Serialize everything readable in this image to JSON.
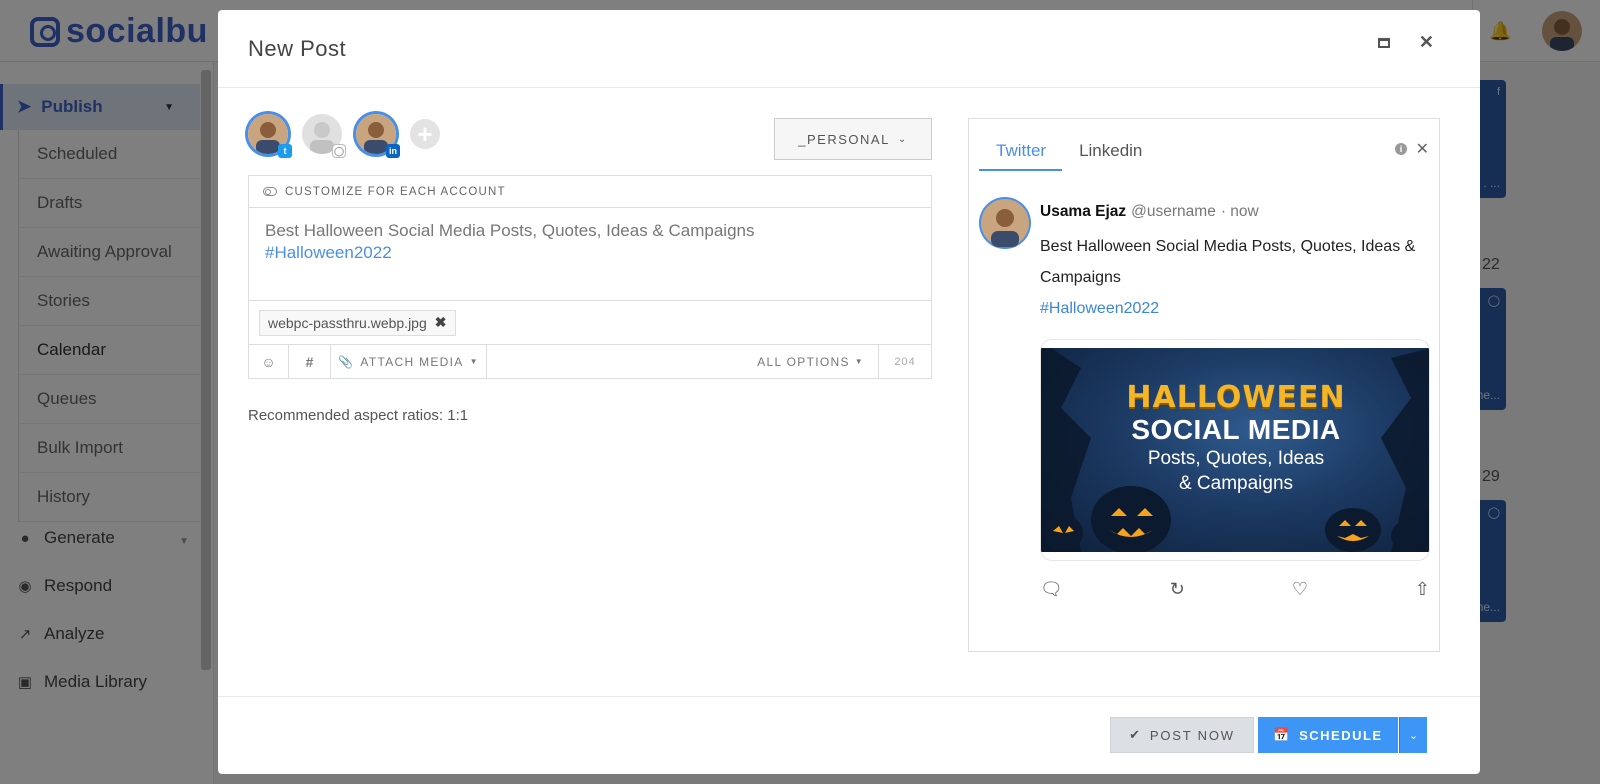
{
  "app": {
    "logo_text": "socialbu"
  },
  "sidebar": {
    "publish_label": "Publish",
    "sub_items": [
      {
        "label": "Scheduled"
      },
      {
        "label": "Drafts"
      },
      {
        "label": "Awaiting Approval"
      },
      {
        "label": "Stories"
      },
      {
        "label": "Calendar"
      },
      {
        "label": "Queues"
      },
      {
        "label": "Bulk Import"
      },
      {
        "label": "History"
      }
    ],
    "main_items": [
      {
        "label": "Generate",
        "icon": "robot-icon"
      },
      {
        "label": "Respond",
        "icon": "chat-icon"
      },
      {
        "label": "Analyze",
        "icon": "chart-icon"
      },
      {
        "label": "Media Library",
        "icon": "image-icon"
      }
    ]
  },
  "calendar": {
    "day_numbers": [
      "22",
      "29"
    ],
    "card_snippets": [
      "day! . . ...",
      ": #me...",
      ": #me..."
    ]
  },
  "modal": {
    "title": "New Post",
    "accounts": [
      {
        "network": "twitter",
        "selected": true
      },
      {
        "network": "instagram",
        "selected": false
      },
      {
        "network": "linkedin",
        "selected": true
      }
    ],
    "account_group_label": "_PERSONAL",
    "customize_label": "CUSTOMIZE FOR EACH ACCOUNT",
    "post_text": "Best Halloween Social Media Posts, Quotes, Ideas & Campaigns",
    "post_hashtag": "#Halloween2022",
    "attachment_filename": "webpc-passthru.webp.jpg",
    "toolbar": {
      "attach_label": "ATTACH MEDIA",
      "options_label": "ALL OPTIONS",
      "char_count": "204"
    },
    "aspect_note": "Recommended aspect ratios: 1:1",
    "footer": {
      "post_now_label": "POST NOW",
      "schedule_label": "SCHEDULE"
    }
  },
  "preview": {
    "tabs": [
      {
        "label": "Twitter",
        "active": true
      },
      {
        "label": "Linkedin",
        "active": false
      }
    ],
    "tweet": {
      "name": "Usama Ejaz",
      "handle": "@username",
      "time": "· now",
      "text": "Best Halloween Social Media Posts, Quotes, Ideas & Campaigns",
      "hashtag": "#Halloween2022",
      "image_text": {
        "line1": "HALLOWEEN",
        "line2": "SOCIAL MEDIA",
        "line3": "Posts, Quotes, Ideas",
        "line4": "& Campaigns"
      }
    }
  },
  "colors": {
    "brand": "#3f63c9",
    "primary_button": "#3d95f5",
    "link": "#4a8fe7"
  }
}
